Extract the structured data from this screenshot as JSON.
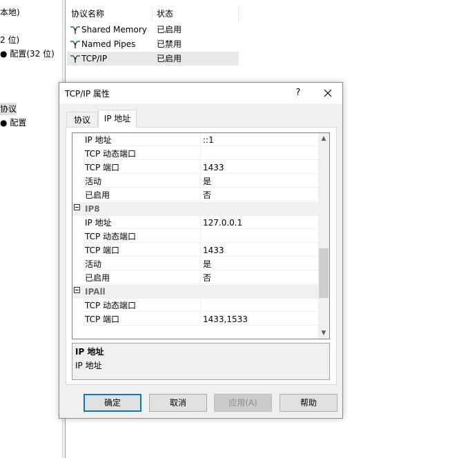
{
  "left_tree": {
    "items": [
      {
        "label": "本地)",
        "selected": false
      },
      {
        "label": "2 位)",
        "selected": false
      },
      {
        "label": "配置(32 位)",
        "selected": false
      },
      {
        "label": "协议",
        "selected": true
      },
      {
        "label": "配置",
        "selected": false
      }
    ]
  },
  "protocol_list": {
    "headers": [
      "协议名称",
      "状态"
    ],
    "rows": [
      {
        "name": "Shared Memory",
        "state": "已启用",
        "selected": false
      },
      {
        "name": "Named Pipes",
        "state": "已禁用",
        "selected": false
      },
      {
        "name": "TCP/IP",
        "state": "已启用",
        "selected": true
      }
    ]
  },
  "dialog": {
    "title": "TCP/IP 属性",
    "help_label": "?",
    "tabs": [
      {
        "label": "协议",
        "active": false
      },
      {
        "label": "IP 地址",
        "active": true
      }
    ],
    "grid_rows": [
      {
        "kind": "prop",
        "name": "IP 地址",
        "value": "::1"
      },
      {
        "kind": "prop",
        "name": "TCP 动态端口",
        "value": ""
      },
      {
        "kind": "prop",
        "name": "TCP 端口",
        "value": "1433"
      },
      {
        "kind": "prop",
        "name": "活动",
        "value": "是"
      },
      {
        "kind": "prop",
        "name": "已启用",
        "value": "否"
      },
      {
        "kind": "category",
        "name": "IP8"
      },
      {
        "kind": "prop",
        "name": "IP 地址",
        "value": "127.0.0.1"
      },
      {
        "kind": "prop",
        "name": "TCP 动态端口",
        "value": ""
      },
      {
        "kind": "prop",
        "name": "TCP 端口",
        "value": "1433"
      },
      {
        "kind": "prop",
        "name": "活动",
        "value": "是"
      },
      {
        "kind": "prop",
        "name": "已启用",
        "value": "否"
      },
      {
        "kind": "category",
        "name": "IPAll"
      },
      {
        "kind": "prop",
        "name": "TCP 动态端口",
        "value": ""
      },
      {
        "kind": "prop",
        "name": "TCP 端口",
        "value": "1433,1533"
      }
    ],
    "scroll_position": 0.78,
    "description": {
      "title": "IP 地址",
      "text": "IP 地址"
    },
    "buttons": {
      "ok": "确定",
      "cancel": "取消",
      "apply": "应用(A)",
      "help": "帮助"
    }
  },
  "colors": {
    "selection": "#e1e1e1",
    "default_button_border": "#0078d7",
    "category_text": "#6d6d6d"
  }
}
